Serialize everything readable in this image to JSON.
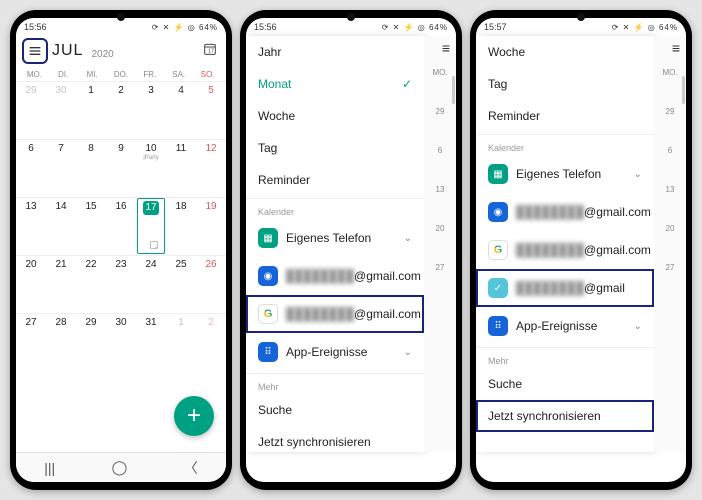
{
  "status": {
    "time1": "15:56",
    "time2": "15:56",
    "time3": "15:57",
    "battery": "64%",
    "icons": "⟳ ✕ ⚡ ◎"
  },
  "screen1": {
    "month": "JUL",
    "year": "2020",
    "today_day": "17",
    "dow": [
      "MO.",
      "DI.",
      "MI.",
      "DO.",
      "FR.",
      "SA.",
      "SO."
    ],
    "grid": [
      [
        {
          "n": "29",
          "dim": true
        },
        {
          "n": "30",
          "dim": true
        },
        {
          "n": "1"
        },
        {
          "n": "2"
        },
        {
          "n": "3"
        },
        {
          "n": "4"
        },
        {
          "n": "5",
          "sun": true
        }
      ],
      [
        {
          "n": "6"
        },
        {
          "n": "7"
        },
        {
          "n": "8"
        },
        {
          "n": "9"
        },
        {
          "n": "10",
          "sub": "|Party"
        },
        {
          "n": "11"
        },
        {
          "n": "12",
          "sun": true
        }
      ],
      [
        {
          "n": "13"
        },
        {
          "n": "14"
        },
        {
          "n": "15"
        },
        {
          "n": "16"
        },
        {
          "n": "17",
          "today": true,
          "note": true
        },
        {
          "n": "18"
        },
        {
          "n": "19",
          "sun": true
        }
      ],
      [
        {
          "n": "20"
        },
        {
          "n": "21"
        },
        {
          "n": "22"
        },
        {
          "n": "23"
        },
        {
          "n": "24"
        },
        {
          "n": "25"
        },
        {
          "n": "26",
          "sun": true
        }
      ],
      [
        {
          "n": "27"
        },
        {
          "n": "28"
        },
        {
          "n": "29"
        },
        {
          "n": "30"
        },
        {
          "n": "31"
        },
        {
          "n": "1",
          "dim": true
        },
        {
          "n": "2",
          "sun": true,
          "dim": true
        }
      ]
    ]
  },
  "drawer": {
    "jahr": "Jahr",
    "monat": "Monat",
    "woche": "Woche",
    "tag": "Tag",
    "reminder": "Reminder",
    "sec_kalender": "Kalender",
    "eigenes": "Eigenes Telefon",
    "gmail_blur": "████████",
    "gmail_suffix": "@gmail.com",
    "gmail_suffix_short": "@gmail",
    "app_ereignisse": "App-Ereignisse",
    "sec_mehr": "Mehr",
    "suche": "Suche",
    "sync": "Jetzt synchronisieren"
  },
  "peek": {
    "dow": "MO.",
    "days": [
      "29",
      "6",
      "13",
      "20",
      "27"
    ]
  },
  "nav": {
    "recent": "|||",
    "home": "◯",
    "back": "〈"
  }
}
